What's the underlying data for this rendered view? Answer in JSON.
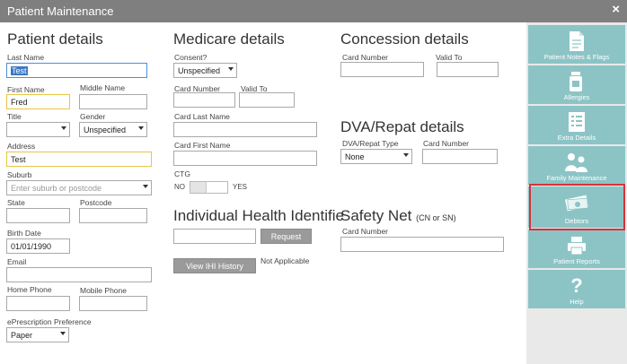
{
  "window": {
    "title": "Patient Maintenance",
    "close_glyph": "×"
  },
  "patient": {
    "heading": "Patient details",
    "last_name": {
      "label": "Last Name",
      "value": "Test"
    },
    "first_name": {
      "label": "First Name",
      "value": "Fred"
    },
    "middle_name": {
      "label": "Middle Name",
      "value": ""
    },
    "title": {
      "label": "Title",
      "value": ""
    },
    "gender": {
      "label": "Gender",
      "value": "Unspecified"
    },
    "address": {
      "label": "Address",
      "value": "Test"
    },
    "suburb": {
      "label": "Suburb",
      "placeholder": "Enter suburb or postcode"
    },
    "state": {
      "label": "State",
      "value": ""
    },
    "postcode": {
      "label": "Postcode",
      "value": ""
    },
    "birth_date": {
      "label": "Birth Date",
      "value": "01/01/1990"
    },
    "email": {
      "label": "Email",
      "value": ""
    },
    "home_phone": {
      "label": "Home Phone",
      "value": ""
    },
    "mobile_phone": {
      "label": "Mobile Phone",
      "value": ""
    },
    "eprescription": {
      "label": "ePrescription Preference",
      "value": "Paper"
    }
  },
  "medicare": {
    "heading": "Medicare details",
    "consent": {
      "label": "Consent?",
      "value": "Unspecified"
    },
    "card_number": {
      "label": "Card Number",
      "value": ""
    },
    "valid_to": {
      "label": "Valid To",
      "value": ""
    },
    "card_last_name": {
      "label": "Card Last Name",
      "value": ""
    },
    "card_first_name": {
      "label": "Card First Name",
      "value": ""
    },
    "ctg": {
      "label": "CTG",
      "no": "NO",
      "yes": "YES"
    }
  },
  "ihi": {
    "heading": "Individual Health Identifie",
    "value": "",
    "request_label": "Request",
    "view_history_label": "View IHI History",
    "status": "Not Applicable"
  },
  "concession": {
    "heading": "Concession details",
    "card_number": {
      "label": "Card Number",
      "value": ""
    },
    "valid_to": {
      "label": "Valid To",
      "value": ""
    }
  },
  "dva": {
    "heading": "DVA/Repat details",
    "type": {
      "label": "DVA/Repat Type",
      "value": "None"
    },
    "card_number": {
      "label": "Card Number",
      "value": ""
    }
  },
  "safety_net": {
    "heading": "Safety Net",
    "subheading": "(CN or SN)",
    "card_number": {
      "label": "Card Number",
      "value": ""
    }
  },
  "sidebar": {
    "items": [
      {
        "label": "Patient Notes & Flags",
        "icon": "document-icon"
      },
      {
        "label": "Allergies",
        "icon": "medicine-bottle-icon"
      },
      {
        "label": "Extra Details",
        "icon": "list-icon"
      },
      {
        "label": "Family Maintenance",
        "icon": "family-icon"
      },
      {
        "label": "Debtors",
        "icon": "money-icon"
      },
      {
        "label": "Patient Reports",
        "icon": "printer-icon"
      },
      {
        "label": "Help",
        "icon": "question-icon"
      }
    ]
  },
  "colors": {
    "titlebar": "#7f7f7f",
    "tile": "#8cc4c6",
    "highlight": "#d9313a",
    "selection": "#3b78c4"
  }
}
